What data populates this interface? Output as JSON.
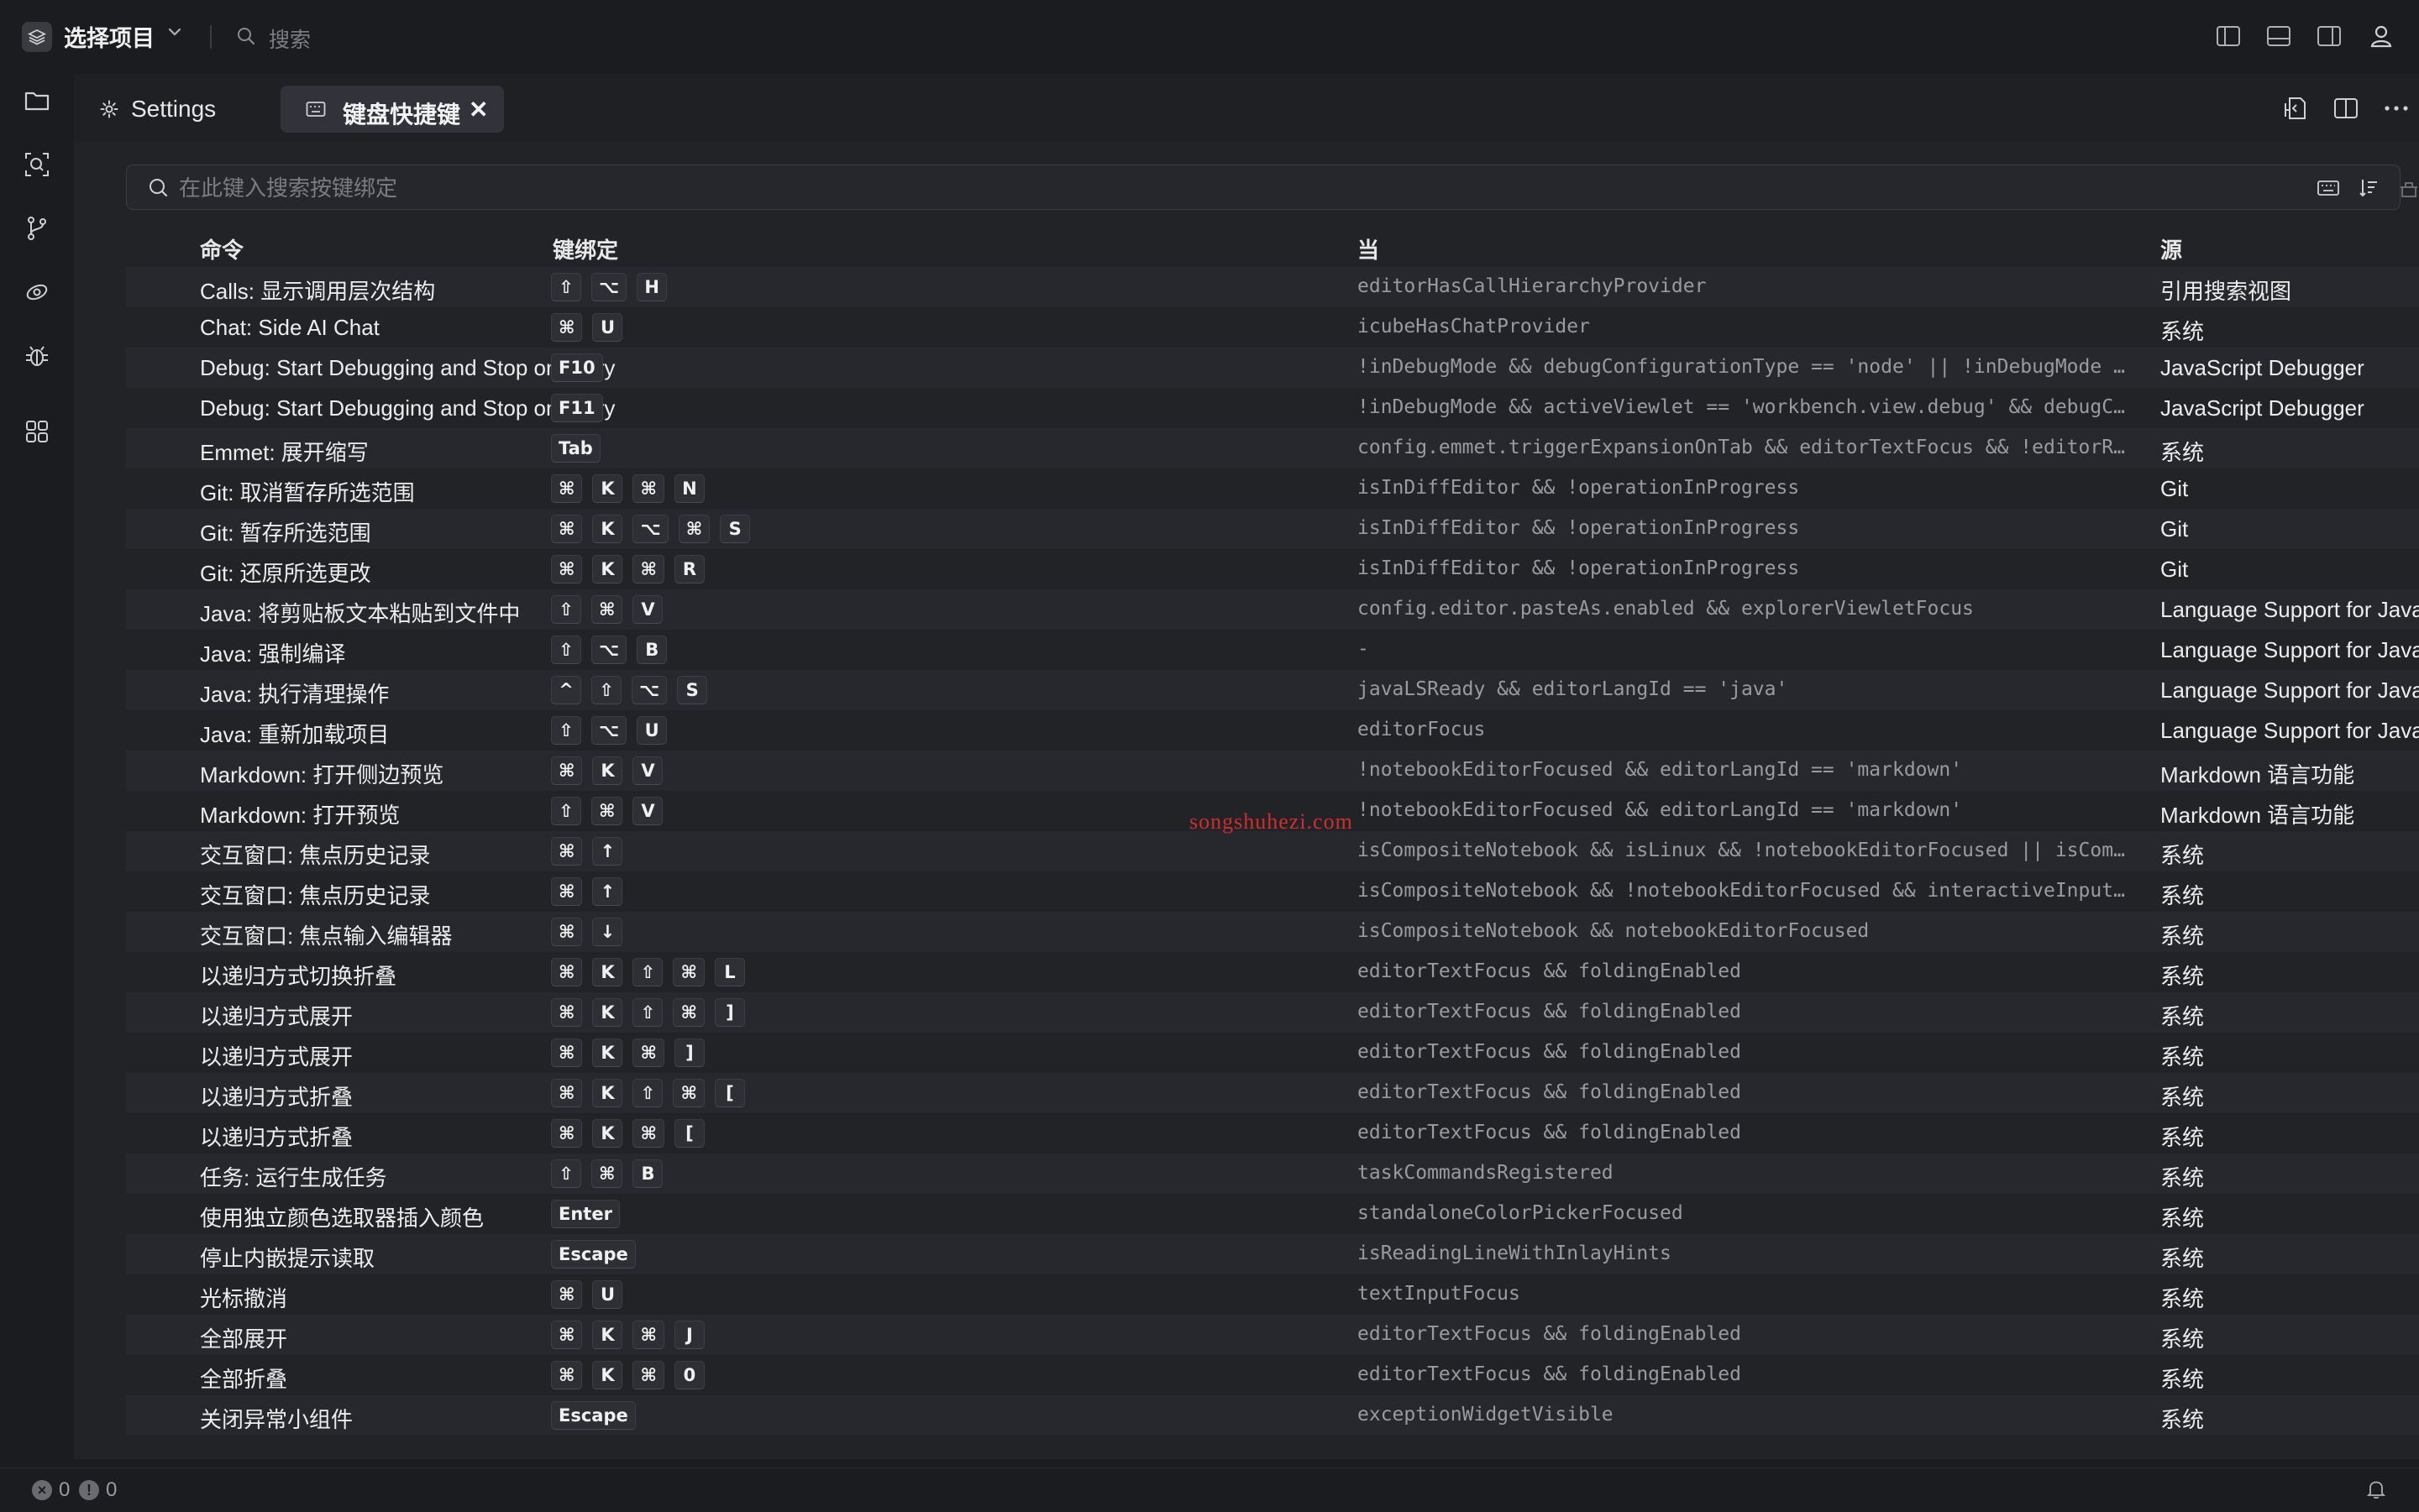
{
  "titlebar": {
    "project_label": "选择项目",
    "search_placeholder": "搜索"
  },
  "tabs": {
    "settings": "Settings",
    "keybindings": "键盘快捷键",
    "close_glyph": "✕"
  },
  "search": {
    "placeholder": "在此键入搜索按键绑定",
    "value": ""
  },
  "table": {
    "headers": {
      "command": "命令",
      "keybinding": "键绑定",
      "when": "当",
      "source": "源"
    },
    "rows": [
      {
        "command": "Calls: 显示调用层次结构",
        "keys": [
          "⇧",
          "⌥",
          "H"
        ],
        "when": "editorHasCallHierarchyProvider",
        "source": "引用搜索视图"
      },
      {
        "command": "Chat: Side AI Chat",
        "keys": [
          "⌘",
          "U"
        ],
        "when": "icubeHasChatProvider",
        "source": "系统"
      },
      {
        "command": "Debug: Start Debugging and Stop on Entry",
        "keys": [
          "F10"
        ],
        "when": "!inDebugMode && debugConfigurationType == 'node' || !inDebugMode …",
        "source": "JavaScript Debugger"
      },
      {
        "command": "Debug: Start Debugging and Stop on Entry",
        "keys": [
          "F11"
        ],
        "when": "!inDebugMode && activeViewlet == 'workbench.view.debug' && debugC…",
        "source": "JavaScript Debugger"
      },
      {
        "command": "Emmet: 展开缩写",
        "keys": [
          "Tab"
        ],
        "when": "config.emmet.triggerExpansionOnTab && editorTextFocus && !editorR…",
        "source": "系统"
      },
      {
        "command": "Git: 取消暂存所选范围",
        "keys": [
          "⌘",
          "K",
          "⌘",
          "N"
        ],
        "when": "isInDiffEditor && !operationInProgress",
        "source": "Git"
      },
      {
        "command": "Git: 暂存所选范围",
        "keys": [
          "⌘",
          "K",
          "⌥",
          "⌘",
          "S"
        ],
        "when": "isInDiffEditor && !operationInProgress",
        "source": "Git"
      },
      {
        "command": "Git: 还原所选更改",
        "keys": [
          "⌘",
          "K",
          "⌘",
          "R"
        ],
        "when": "isInDiffEditor && !operationInProgress",
        "source": "Git"
      },
      {
        "command": "Java: 将剪贴板文本粘贴到文件中",
        "keys": [
          "⇧",
          "⌘",
          "V"
        ],
        "when": "config.editor.pasteAs.enabled && explorerViewletFocus",
        "source": "Language Support for Java"
      },
      {
        "command": "Java: 强制编译",
        "keys": [
          "⇧",
          "⌥",
          "B"
        ],
        "when": "-",
        "source": "Language Support for Java"
      },
      {
        "command": "Java: 执行清理操作",
        "keys": [
          "^",
          "⇧",
          "⌥",
          "S"
        ],
        "when": "javaLSReady && editorLangId == 'java'",
        "source": "Language Support for Java"
      },
      {
        "command": "Java: 重新加载项目",
        "keys": [
          "⇧",
          "⌥",
          "U"
        ],
        "when": "editorFocus",
        "source": "Language Support for Java"
      },
      {
        "command": "Markdown: 打开侧边预览",
        "keys": [
          "⌘",
          "K",
          "V"
        ],
        "when": "!notebookEditorFocused && editorLangId == 'markdown'",
        "source": "Markdown 语言功能"
      },
      {
        "command": "Markdown: 打开预览",
        "keys": [
          "⇧",
          "⌘",
          "V"
        ],
        "when": "!notebookEditorFocused && editorLangId == 'markdown'",
        "source": "Markdown 语言功能"
      },
      {
        "command": "交互窗口: 焦点历史记录",
        "keys": [
          "⌘",
          "↑"
        ],
        "when": "isCompositeNotebook && isLinux && !notebookEditorFocused || isCom…",
        "source": "系统"
      },
      {
        "command": "交互窗口: 焦点历史记录",
        "keys": [
          "⌘",
          "↑"
        ],
        "when": "isCompositeNotebook && !notebookEditorFocused && interactiveInput…",
        "source": "系统"
      },
      {
        "command": "交互窗口: 焦点输入编辑器",
        "keys": [
          "⌘",
          "↓"
        ],
        "when": "isCompositeNotebook && notebookEditorFocused",
        "source": "系统"
      },
      {
        "command": "以递归方式切换折叠",
        "keys": [
          "⌘",
          "K",
          "⇧",
          "⌘",
          "L"
        ],
        "when": "editorTextFocus && foldingEnabled",
        "source": "系统"
      },
      {
        "command": "以递归方式展开",
        "keys": [
          "⌘",
          "K",
          "⇧",
          "⌘",
          "]"
        ],
        "when": "editorTextFocus && foldingEnabled",
        "source": "系统"
      },
      {
        "command": "以递归方式展开",
        "keys": [
          "⌘",
          "K",
          "⌘",
          "]"
        ],
        "when": "editorTextFocus && foldingEnabled",
        "source": "系统"
      },
      {
        "command": "以递归方式折叠",
        "keys": [
          "⌘",
          "K",
          "⇧",
          "⌘",
          "["
        ],
        "when": "editorTextFocus && foldingEnabled",
        "source": "系统"
      },
      {
        "command": "以递归方式折叠",
        "keys": [
          "⌘",
          "K",
          "⌘",
          "["
        ],
        "when": "editorTextFocus && foldingEnabled",
        "source": "系统"
      },
      {
        "command": "任务: 运行生成任务",
        "keys": [
          "⇧",
          "⌘",
          "B"
        ],
        "when": "taskCommandsRegistered",
        "source": "系统"
      },
      {
        "command": "使用独立颜色选取器插入颜色",
        "keys": [
          "Enter"
        ],
        "when": "standaloneColorPickerFocused",
        "source": "系统"
      },
      {
        "command": "停止内嵌提示读取",
        "keys": [
          "Escape"
        ],
        "when": "isReadingLineWithInlayHints",
        "source": "系统"
      },
      {
        "command": "光标撤消",
        "keys": [
          "⌘",
          "U"
        ],
        "when": "textInputFocus",
        "source": "系统"
      },
      {
        "command": "全部展开",
        "keys": [
          "⌘",
          "K",
          "⌘",
          "J"
        ],
        "when": "editorTextFocus && foldingEnabled",
        "source": "系统"
      },
      {
        "command": "全部折叠",
        "keys": [
          "⌘",
          "K",
          "⌘",
          "0"
        ],
        "when": "editorTextFocus && foldingEnabled",
        "source": "系统"
      },
      {
        "command": "关闭异常小组件",
        "keys": [
          "Escape"
        ],
        "when": "exceptionWidgetVisible",
        "source": "系统"
      }
    ]
  },
  "watermark": "songshuhezi.com",
  "statusbar": {
    "errors": "0",
    "warnings": "0"
  },
  "colors": {
    "background": "#1b1c1f",
    "editor": "#222327",
    "tab_active": "#32333a",
    "watermark": "#d12d2d"
  }
}
